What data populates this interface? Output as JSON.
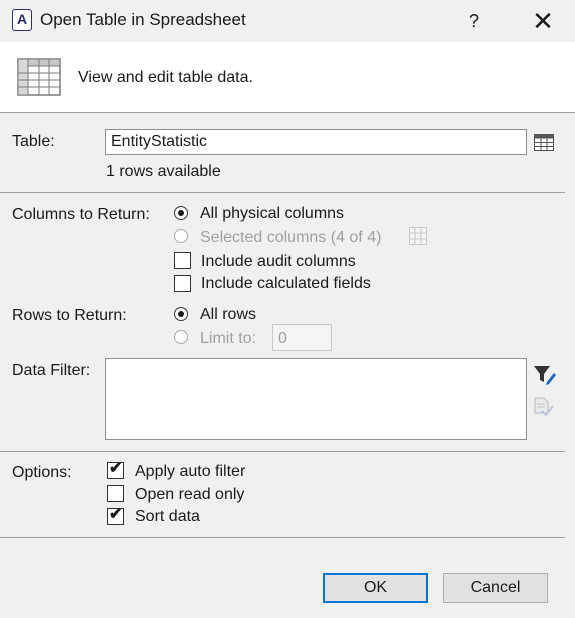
{
  "window": {
    "title": "Open Table in Spreadsheet",
    "help": "?",
    "close": "✕",
    "app_icon_letter": "A"
  },
  "header": {
    "text": "View and edit table data."
  },
  "table": {
    "label": "Table:",
    "value": "EntityStatistic",
    "rows_available": "1 rows available"
  },
  "columns": {
    "label": "Columns to Return:",
    "all_physical": "All physical columns",
    "selected": "Selected columns (4 of 4)",
    "include_audit": "Include audit columns",
    "include_calculated": "Include calculated fields"
  },
  "rows": {
    "label": "Rows to Return:",
    "all_rows": "All rows",
    "limit_to": "Limit to:",
    "limit_value": "0"
  },
  "filter": {
    "label": "Data Filter:",
    "value": ""
  },
  "options": {
    "label": "Options:",
    "apply_auto_filter": "Apply auto filter",
    "open_read_only": "Open read only",
    "sort_data": "Sort data"
  },
  "buttons": {
    "ok": "OK",
    "cancel": "Cancel"
  },
  "colors": {
    "accent": "#0078d7",
    "disabled": "#a0a0a0"
  }
}
